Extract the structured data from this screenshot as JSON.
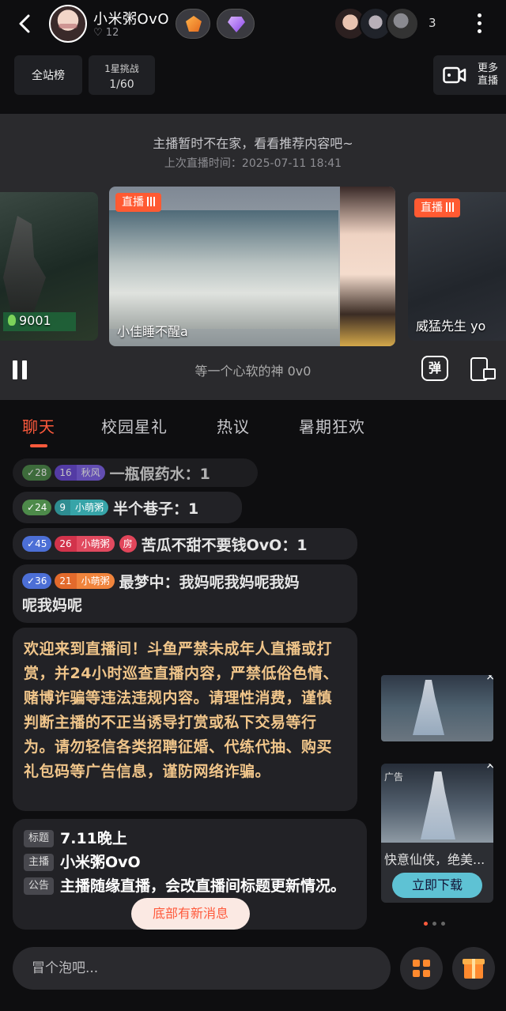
{
  "header": {
    "anchor_name": "小米粥OvO",
    "fans_count": "12",
    "viewer_count": "3",
    "icons": [
      "back-arrow-icon",
      "rank-badge-icon",
      "diamond-badge-icon",
      "more-icon"
    ]
  },
  "ranking": {
    "site_rank_label": "全站榜",
    "star_challenge_title": "1星挑战",
    "star_challenge_progress": "1/60",
    "more_live_label": "更多直播"
  },
  "offline_panel": {
    "message": "主播暂时不在家，看看推荐内容吧~",
    "last_live_time": "上次直播时间：2025-07-11 18:41",
    "cards": [
      {
        "tag": "",
        "title": "",
        "hot_count": "9001"
      },
      {
        "tag": "直播",
        "title": "小佳睡不醒a"
      },
      {
        "tag": "直播",
        "title": "威猛先生 yo"
      }
    ],
    "now_playing": "等一个心软的神 0v0",
    "danmu_label": "弹"
  },
  "tabs": [
    "聊天",
    "校园星礼",
    "热议",
    "暑期狂欢"
  ],
  "active_tab": 0,
  "chat": [
    {
      "level": "28",
      "fan_level": "16",
      "fan_title": "秋风",
      "room": false,
      "content": "一瓶假药水：1"
    },
    {
      "level": "24",
      "fan_level": "9",
      "fan_title": "小萌粥",
      "room": false,
      "content": "半个巷子：1"
    },
    {
      "level": "45",
      "fan_level": "26",
      "fan_title": "小萌粥",
      "room": true,
      "room_label": "房",
      "content": "苦瓜不甜不要钱OvO：1"
    },
    {
      "level": "36",
      "fan_level": "21",
      "fan_title": "小萌粥",
      "room": false,
      "content_line1": "最梦中：我妈呢我妈呢我妈",
      "content_line2": "呢我妈呢"
    }
  ],
  "notice": "欢迎来到直播间！斗鱼严禁未成年人直播或打赏，并24小时巡查直播内容，严禁低俗色情、赌博诈骗等违法违规内容。请理性消费，谨慎判断主播的不正当诱导打赏或私下交易等行为。请勿轻信各类招聘征婚、代练代抽、购买礼包码等广告信息，谨防网络诈骗。",
  "room_info": {
    "title_tag": "标题",
    "title_value": "7.11晚上",
    "anchor_tag": "主播",
    "anchor_value": "小米粥OvO",
    "announce_tag": "公告",
    "announce_value": "主播随缘直播，会改直播间标题更新情况。"
  },
  "new_message_label": "底部有新消息",
  "ads": {
    "label": "广告",
    "title": "快意仙侠，绝美...",
    "download_label": "立即下载",
    "close": "×"
  },
  "bottom_bar": {
    "input_placeholder": "冒个泡吧..."
  },
  "colors": {
    "accent": "#ff5a3c",
    "notice_text": "#f0c58a",
    "background": "#0e0e10"
  }
}
